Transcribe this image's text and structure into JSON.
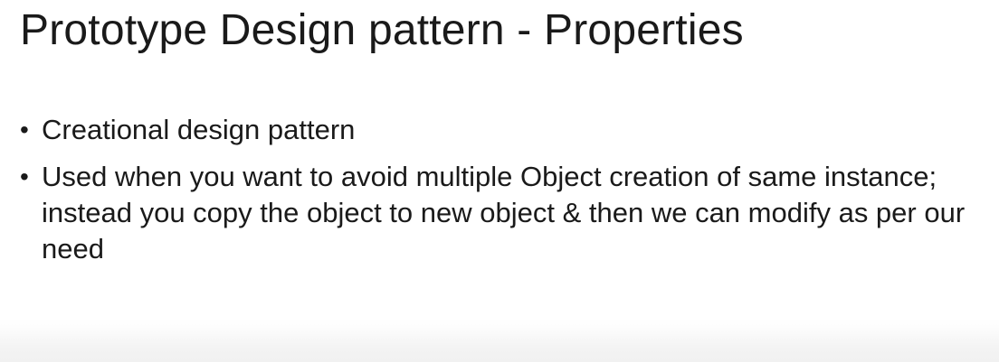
{
  "slide": {
    "title": "Prototype Design pattern - Properties",
    "bullets": [
      {
        "marker": "•",
        "text": "Creational design pattern"
      },
      {
        "marker": "•",
        "text": "Used when you want to avoid multiple Object creation of same instance; instead you copy the object to new object & then we can modify as per our need"
      }
    ]
  }
}
